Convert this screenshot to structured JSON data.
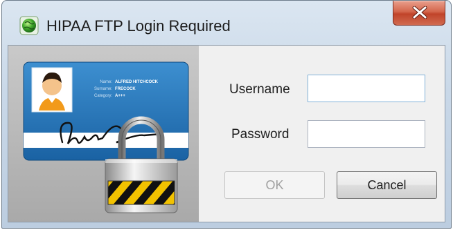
{
  "window": {
    "title": "HIPAA FTP Login Required",
    "close_icon": "close-x-icon"
  },
  "id_card": {
    "name_label": "Name:",
    "name_value": "ALFRED HITCHCOCK",
    "surname_label": "Surname:",
    "surname_value": "FRECOCK",
    "category_label": "Category:",
    "category_value": "A+++",
    "card_color": "#1f6fb0"
  },
  "form": {
    "username_label": "Username",
    "username_value": "",
    "password_label": "Password",
    "password_value": ""
  },
  "buttons": {
    "ok_label": "OK",
    "ok_enabled": false,
    "cancel_label": "Cancel"
  },
  "colors": {
    "close_button": "#c94a2f",
    "title_bar": "#c9d8e8"
  }
}
